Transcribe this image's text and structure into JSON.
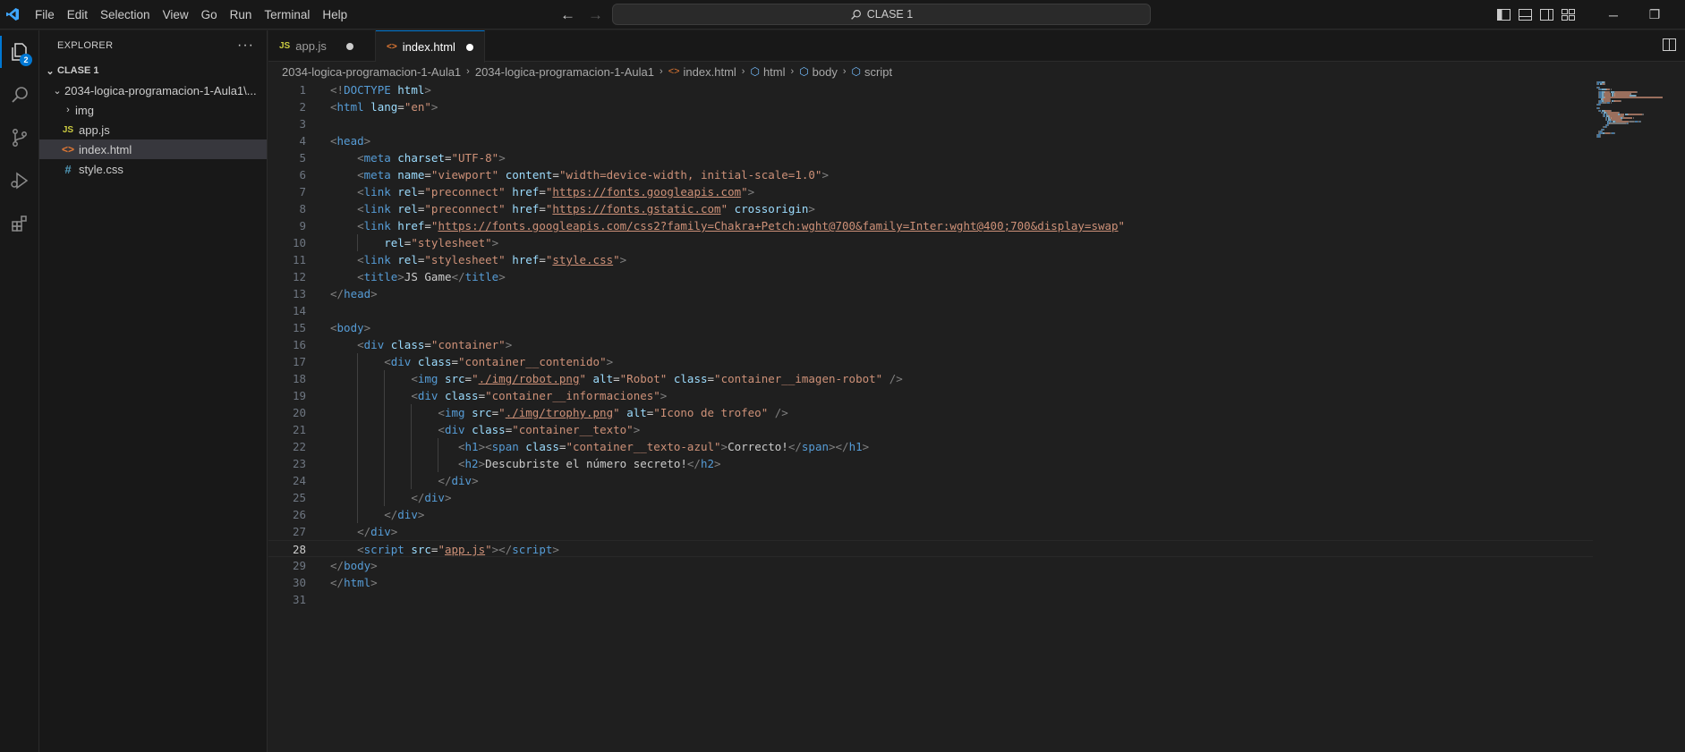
{
  "titlebar": {
    "menu": [
      "File",
      "Edit",
      "Selection",
      "View",
      "Go",
      "Run",
      "Terminal",
      "Help"
    ],
    "search_text": "CLASE 1",
    "colors": {
      "accent": "#0078d4",
      "background": "#1f1f1f"
    }
  },
  "activity_bar": {
    "explorer_badge": "2",
    "icons": [
      "files-icon",
      "search-icon",
      "source-control-icon",
      "run-debug-icon",
      "extensions-icon"
    ]
  },
  "sidebar": {
    "title": "EXPLORER",
    "section": "CLASE 1",
    "folder": "2034-logica-programacion-1-Aula1\\...",
    "items": [
      {
        "label": "img",
        "type": "folder"
      },
      {
        "label": "app.js",
        "type": "js",
        "icon_text": "JS"
      },
      {
        "label": "index.html",
        "type": "html",
        "icon_text": "<>"
      },
      {
        "label": "style.css",
        "type": "css",
        "icon_text": "#"
      }
    ]
  },
  "tabs": [
    {
      "label": "app.js",
      "icon_text": "JS",
      "modified": true,
      "active": false
    },
    {
      "label": "index.html",
      "icon_text": "<>",
      "modified": true,
      "active": true
    }
  ],
  "breadcrumb": [
    "2034-logica-programacion-1-Aula1",
    "2034-logica-programacion-1-Aula1",
    "index.html",
    "html",
    "body",
    "script"
  ],
  "editor": {
    "current_line": 28,
    "lines": [
      [
        [
          "p",
          "<!"
        ],
        [
          "t",
          "DOCTYPE"
        ],
        [
          "d",
          " "
        ],
        [
          "a",
          "html"
        ],
        [
          "p",
          ">"
        ]
      ],
      [
        [
          "p",
          "<"
        ],
        [
          "t",
          "html"
        ],
        [
          "d",
          " "
        ],
        [
          "a",
          "lang"
        ],
        [
          "d",
          "="
        ],
        [
          "s",
          "\"en\""
        ],
        [
          "p",
          ">"
        ]
      ],
      [],
      [
        [
          "p",
          "<"
        ],
        [
          "t",
          "head"
        ],
        [
          "p",
          ">"
        ]
      ],
      [
        [
          "d",
          "    "
        ],
        [
          "p",
          "<"
        ],
        [
          "t",
          "meta"
        ],
        [
          "d",
          " "
        ],
        [
          "a",
          "charset"
        ],
        [
          "d",
          "="
        ],
        [
          "s",
          "\"UTF-8\""
        ],
        [
          "p",
          ">"
        ]
      ],
      [
        [
          "d",
          "    "
        ],
        [
          "p",
          "<"
        ],
        [
          "t",
          "meta"
        ],
        [
          "d",
          " "
        ],
        [
          "a",
          "name"
        ],
        [
          "d",
          "="
        ],
        [
          "s",
          "\"viewport\""
        ],
        [
          "d",
          " "
        ],
        [
          "a",
          "content"
        ],
        [
          "d",
          "="
        ],
        [
          "s",
          "\"width=device-width, initial-scale=1.0\""
        ],
        [
          "p",
          ">"
        ]
      ],
      [
        [
          "d",
          "    "
        ],
        [
          "p",
          "<"
        ],
        [
          "t",
          "link"
        ],
        [
          "d",
          " "
        ],
        [
          "a",
          "rel"
        ],
        [
          "d",
          "="
        ],
        [
          "s",
          "\"preconnect\""
        ],
        [
          "d",
          " "
        ],
        [
          "a",
          "href"
        ],
        [
          "d",
          "="
        ],
        [
          "s",
          "\""
        ],
        [
          "u",
          "https://fonts.googleapis.com"
        ],
        [
          "s",
          "\""
        ],
        [
          "p",
          ">"
        ]
      ],
      [
        [
          "d",
          "    "
        ],
        [
          "p",
          "<"
        ],
        [
          "t",
          "link"
        ],
        [
          "d",
          " "
        ],
        [
          "a",
          "rel"
        ],
        [
          "d",
          "="
        ],
        [
          "s",
          "\"preconnect\""
        ],
        [
          "d",
          " "
        ],
        [
          "a",
          "href"
        ],
        [
          "d",
          "="
        ],
        [
          "s",
          "\""
        ],
        [
          "u",
          "https://fonts.gstatic.com"
        ],
        [
          "s",
          "\""
        ],
        [
          "d",
          " "
        ],
        [
          "a",
          "crossorigin"
        ],
        [
          "p",
          ">"
        ]
      ],
      [
        [
          "d",
          "    "
        ],
        [
          "p",
          "<"
        ],
        [
          "t",
          "link"
        ],
        [
          "d",
          " "
        ],
        [
          "a",
          "href"
        ],
        [
          "d",
          "="
        ],
        [
          "s",
          "\""
        ],
        [
          "u",
          "https://fonts.googleapis.com/css2?family=Chakra+Petch:wght@700&family=Inter:wght@400;700&display=swap"
        ],
        [
          "s",
          "\""
        ]
      ],
      [
        [
          "d",
          "        "
        ],
        [
          "a",
          "rel"
        ],
        [
          "d",
          "="
        ],
        [
          "s",
          "\"stylesheet\""
        ],
        [
          "p",
          ">"
        ]
      ],
      [
        [
          "d",
          "    "
        ],
        [
          "p",
          "<"
        ],
        [
          "t",
          "link"
        ],
        [
          "d",
          " "
        ],
        [
          "a",
          "rel"
        ],
        [
          "d",
          "="
        ],
        [
          "s",
          "\"stylesheet\""
        ],
        [
          "d",
          " "
        ],
        [
          "a",
          "href"
        ],
        [
          "d",
          "="
        ],
        [
          "s",
          "\""
        ],
        [
          "u",
          "style.css"
        ],
        [
          "s",
          "\""
        ],
        [
          "p",
          ">"
        ]
      ],
      [
        [
          "d",
          "    "
        ],
        [
          "p",
          "<"
        ],
        [
          "t",
          "title"
        ],
        [
          "p",
          ">"
        ],
        [
          "d",
          "JS Game"
        ],
        [
          "p",
          "</"
        ],
        [
          "t",
          "title"
        ],
        [
          "p",
          ">"
        ]
      ],
      [
        [
          "p",
          "</"
        ],
        [
          "t",
          "head"
        ],
        [
          "p",
          ">"
        ]
      ],
      [],
      [
        [
          "p",
          "<"
        ],
        [
          "t",
          "body"
        ],
        [
          "p",
          ">"
        ]
      ],
      [
        [
          "d",
          "    "
        ],
        [
          "p",
          "<"
        ],
        [
          "t",
          "div"
        ],
        [
          "d",
          " "
        ],
        [
          "a",
          "class"
        ],
        [
          "d",
          "="
        ],
        [
          "s",
          "\"container\""
        ],
        [
          "p",
          ">"
        ]
      ],
      [
        [
          "d",
          "        "
        ],
        [
          "p",
          "<"
        ],
        [
          "t",
          "div"
        ],
        [
          "d",
          " "
        ],
        [
          "a",
          "class"
        ],
        [
          "d",
          "="
        ],
        [
          "s",
          "\"container__contenido\""
        ],
        [
          "p",
          ">"
        ]
      ],
      [
        [
          "d",
          "            "
        ],
        [
          "p",
          "<"
        ],
        [
          "t",
          "img"
        ],
        [
          "d",
          " "
        ],
        [
          "a",
          "src"
        ],
        [
          "d",
          "="
        ],
        [
          "s",
          "\""
        ],
        [
          "u",
          "./img/robot.png"
        ],
        [
          "s",
          "\""
        ],
        [
          "d",
          " "
        ],
        [
          "a",
          "alt"
        ],
        [
          "d",
          "="
        ],
        [
          "s",
          "\"Robot\""
        ],
        [
          "d",
          " "
        ],
        [
          "a",
          "class"
        ],
        [
          "d",
          "="
        ],
        [
          "s",
          "\"container__imagen-robot\""
        ],
        [
          "d",
          " "
        ],
        [
          "p",
          "/>"
        ]
      ],
      [
        [
          "d",
          "            "
        ],
        [
          "p",
          "<"
        ],
        [
          "t",
          "div"
        ],
        [
          "d",
          " "
        ],
        [
          "a",
          "class"
        ],
        [
          "d",
          "="
        ],
        [
          "s",
          "\"container__informaciones\""
        ],
        [
          "p",
          ">"
        ]
      ],
      [
        [
          "d",
          "                "
        ],
        [
          "p",
          "<"
        ],
        [
          "t",
          "img"
        ],
        [
          "d",
          " "
        ],
        [
          "a",
          "src"
        ],
        [
          "d",
          "="
        ],
        [
          "s",
          "\""
        ],
        [
          "u",
          "./img/trophy.png"
        ],
        [
          "s",
          "\""
        ],
        [
          "d",
          " "
        ],
        [
          "a",
          "alt"
        ],
        [
          "d",
          "="
        ],
        [
          "s",
          "\"Icono de trofeo\""
        ],
        [
          "d",
          " "
        ],
        [
          "p",
          "/>"
        ]
      ],
      [
        [
          "d",
          "                "
        ],
        [
          "p",
          "<"
        ],
        [
          "t",
          "div"
        ],
        [
          "d",
          " "
        ],
        [
          "a",
          "class"
        ],
        [
          "d",
          "="
        ],
        [
          "s",
          "\"container__texto\""
        ],
        [
          "p",
          ">"
        ]
      ],
      [
        [
          "d",
          "                   "
        ],
        [
          "p",
          "<"
        ],
        [
          "t",
          "h1"
        ],
        [
          "p",
          "><"
        ],
        [
          "t",
          "span"
        ],
        [
          "d",
          " "
        ],
        [
          "a",
          "class"
        ],
        [
          "d",
          "="
        ],
        [
          "s",
          "\"container__texto-azul\""
        ],
        [
          "p",
          ">"
        ],
        [
          "d",
          "Correcto!"
        ],
        [
          "p",
          "</"
        ],
        [
          "t",
          "span"
        ],
        [
          "p",
          "></"
        ],
        [
          "t",
          "h1"
        ],
        [
          "p",
          ">"
        ]
      ],
      [
        [
          "d",
          "                   "
        ],
        [
          "p",
          "<"
        ],
        [
          "t",
          "h2"
        ],
        [
          "p",
          ">"
        ],
        [
          "d",
          "Descubriste el número secreto!"
        ],
        [
          "p",
          "</"
        ],
        [
          "t",
          "h2"
        ],
        [
          "p",
          ">"
        ]
      ],
      [
        [
          "d",
          "                "
        ],
        [
          "p",
          "</"
        ],
        [
          "t",
          "div"
        ],
        [
          "p",
          ">"
        ]
      ],
      [
        [
          "d",
          "            "
        ],
        [
          "p",
          "</"
        ],
        [
          "t",
          "div"
        ],
        [
          "p",
          ">"
        ]
      ],
      [
        [
          "d",
          "        "
        ],
        [
          "p",
          "</"
        ],
        [
          "t",
          "div"
        ],
        [
          "p",
          ">"
        ]
      ],
      [
        [
          "d",
          "    "
        ],
        [
          "p",
          "</"
        ],
        [
          "t",
          "div"
        ],
        [
          "p",
          ">"
        ]
      ],
      [
        [
          "d",
          "    "
        ],
        [
          "p",
          "<"
        ],
        [
          "t",
          "script"
        ],
        [
          "d",
          " "
        ],
        [
          "a",
          "src"
        ],
        [
          "d",
          "="
        ],
        [
          "s",
          "\""
        ],
        [
          "u",
          "app.js"
        ],
        [
          "s",
          "\""
        ],
        [
          "p",
          "></"
        ],
        [
          "t",
          "script"
        ],
        [
          "p",
          ">"
        ]
      ],
      [
        [
          "p",
          "</"
        ],
        [
          "t",
          "body"
        ],
        [
          "p",
          ">"
        ]
      ],
      [
        [
          "p",
          "</"
        ],
        [
          "t",
          "html"
        ],
        [
          "p",
          ">"
        ]
      ],
      []
    ]
  }
}
